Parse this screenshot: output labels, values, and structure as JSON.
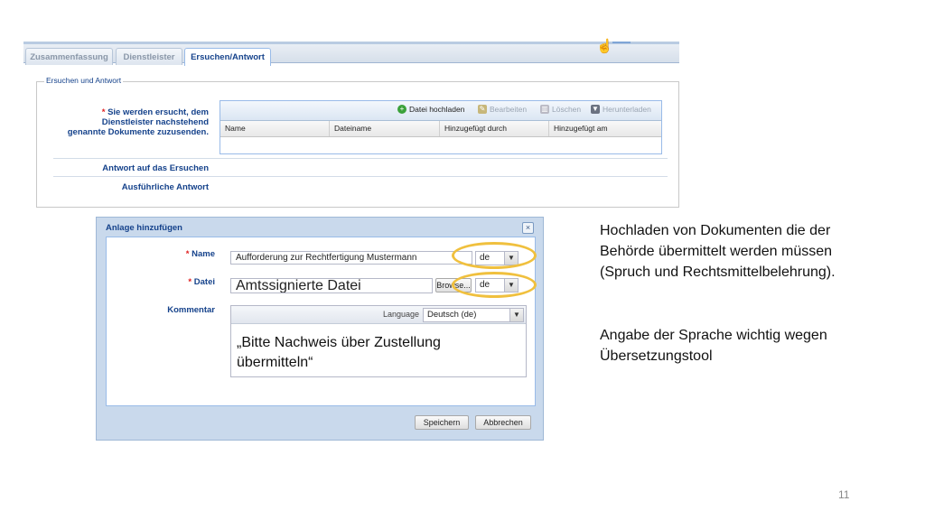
{
  "tabs": [
    {
      "label": "Zusammenfassung"
    },
    {
      "label": "Dienstleister"
    },
    {
      "label": "Ersuchen/Antwort"
    }
  ],
  "form": {
    "legend": "Ersuchen und Antwort",
    "required_star": "*",
    "required_text": "Sie werden ersucht, dem Dienstleister nachstehend genannte Dokumente zuzusenden.",
    "answer_label": "Antwort auf das Ersuchen",
    "detailed_answer_label": "Ausführliche Antwort"
  },
  "toolbar": {
    "upload": "Datei hochladen",
    "edit": "Bearbeiten",
    "delete": "Löschen",
    "download": "Herunterladen"
  },
  "grid_columns": [
    "Name",
    "Dateiname",
    "Hinzugefügt durch",
    "Hinzugefügt am"
  ],
  "dialog": {
    "title": "Anlage hinzufügen",
    "close": "×",
    "name_label": "Name",
    "file_label": "Datei",
    "comment_label": "Kommentar",
    "name_value": "Aufforderung zur Rechtfertigung Mustermann",
    "name_lang": "de",
    "file_value": "Amtssignierte Datei",
    "browse": "Browse...",
    "file_lang": "de",
    "language_label": "Language",
    "language_value": "Deutsch (de)",
    "comment_text": "„Bitte Nachweis über Zustellung übermitteln“",
    "save": "Speichern",
    "cancel": "Abbrechen"
  },
  "notes": {
    "upload_note": "Hochladen von Dokumenten die der Behörde übermittelt werden müssen (Spruch und Rechtsmittelbelehrung).",
    "language_note": "Angabe der Sprache wichtig wegen Übersetzungstool"
  },
  "page_number": "11",
  "colors": {
    "accent": "#15428b",
    "highlight": "#f0c03e",
    "required": "#e02020"
  }
}
